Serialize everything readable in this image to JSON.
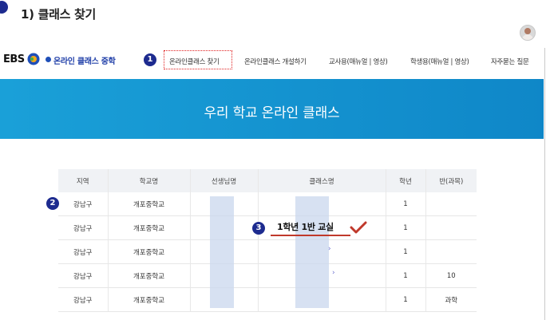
{
  "caption": {
    "title": "1) 클래스 찾기"
  },
  "logo": {
    "brand": "EBS",
    "service": "온라인 클래스 중학"
  },
  "nav": {
    "badge": "1",
    "items": [
      "온라인클래스 찾기",
      "온라인클래스 개설하기",
      "교사용(매뉴얼 | 영상)",
      "학생용(매뉴얼 | 영상)",
      "자주묻는 질문"
    ]
  },
  "banner": {
    "title": "우리 학교 온라인 클래스"
  },
  "table": {
    "headers": [
      "지역",
      "학교명",
      "선생님명",
      "클래스명",
      "학년",
      "반(과목)"
    ],
    "rows": [
      [
        "강남구",
        "개포중학교",
        "",
        "",
        "1",
        ""
      ],
      [
        "강남구",
        "개포중학교",
        "",
        "",
        "1",
        ""
      ],
      [
        "강남구",
        "개포중학교",
        "",
        "",
        "1",
        ""
      ],
      [
        "강남구",
        "개포중학교",
        "",
        "",
        "1",
        "10"
      ],
      [
        "강남구",
        "개포중학교",
        "",
        "",
        "1",
        "과학"
      ]
    ]
  },
  "annotations": {
    "badge2": "2",
    "badge3": "3",
    "class_label": "1학년 1반 교실",
    "accent_color": "#1d2b8f",
    "highlight_color": "#e02020"
  },
  "icons": {
    "check": "check-icon",
    "chevron": "chevron-right-icon",
    "avatar": "avatar-icon"
  }
}
